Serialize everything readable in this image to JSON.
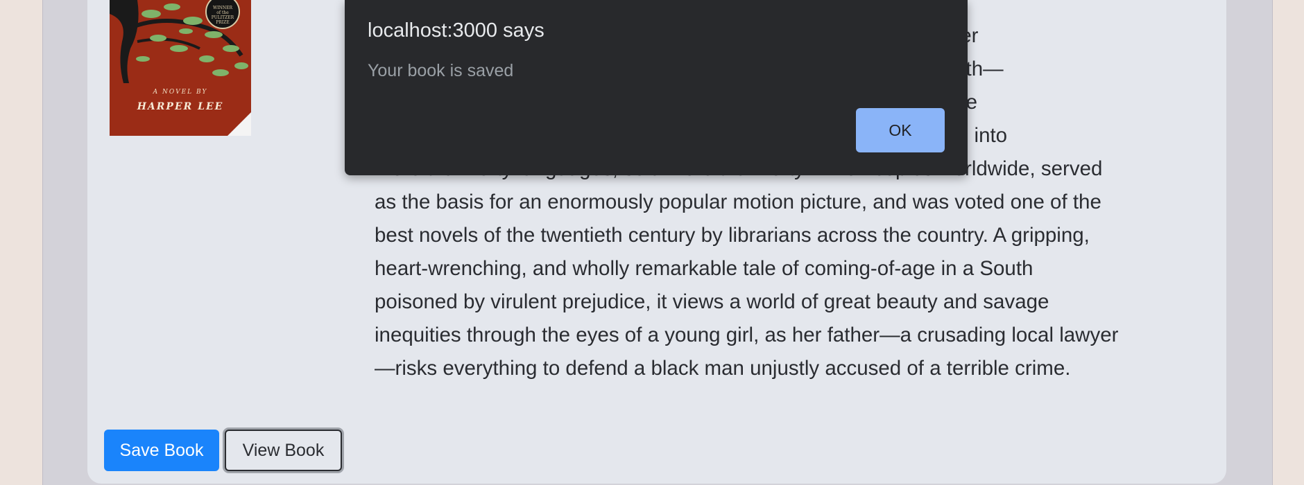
{
  "book": {
    "cover": {
      "seal_text": "WINNER of the PULITZER PRIZE",
      "subtitle": "A NOVEL BY",
      "author": "HARPER LEE"
    },
    "description_visible": "erican Read Harper … stice in the deep South— … t hatred One of the … s been translated into … opies worldwide, served as the basis for an enormously popular motion picture, and was voted one of the best novels of the twentieth century by librarians across the country. A gripping, heart-wrenching, and wholly remarkable tale of coming-of-age in a South poisoned by virulent prejudice, it views a world of great beauty and savage inequities through the eyes of a young girl, as her father—a crusading local lawyer—risks everything to defend a black man unjustly accused of a terrible crime.",
    "description_lines": [
      "erican Read Harper",
      "stice in the deep South—",
      "t hatred One of the",
      "s been translated into",
      "more than forty languages, sold more than forty million copies worldwide, served",
      "as the basis for an enormously popular motion picture, and was voted one of the",
      "best novels of the twentieth century by librarians across the country. A gripping,",
      "heart-wrenching, and wholly remarkable tale of coming-of-age in a South",
      "poisoned by virulent prejudice, it views a world of great beauty and savage",
      "inequities through the eyes of a young girl, as her father—a crusading local lawyer",
      "—risks everything to defend a black man unjustly accused of a terrible crime."
    ]
  },
  "actions": {
    "save_label": "Save Book",
    "view_label": "View Book"
  },
  "dialog": {
    "origin": "localhost:3000 says",
    "message": "Your book is saved",
    "ok_label": "OK"
  },
  "colors": {
    "primary": "#1a84fb",
    "dialog_bg": "#28292c",
    "dialog_button": "#8ab4f8"
  }
}
